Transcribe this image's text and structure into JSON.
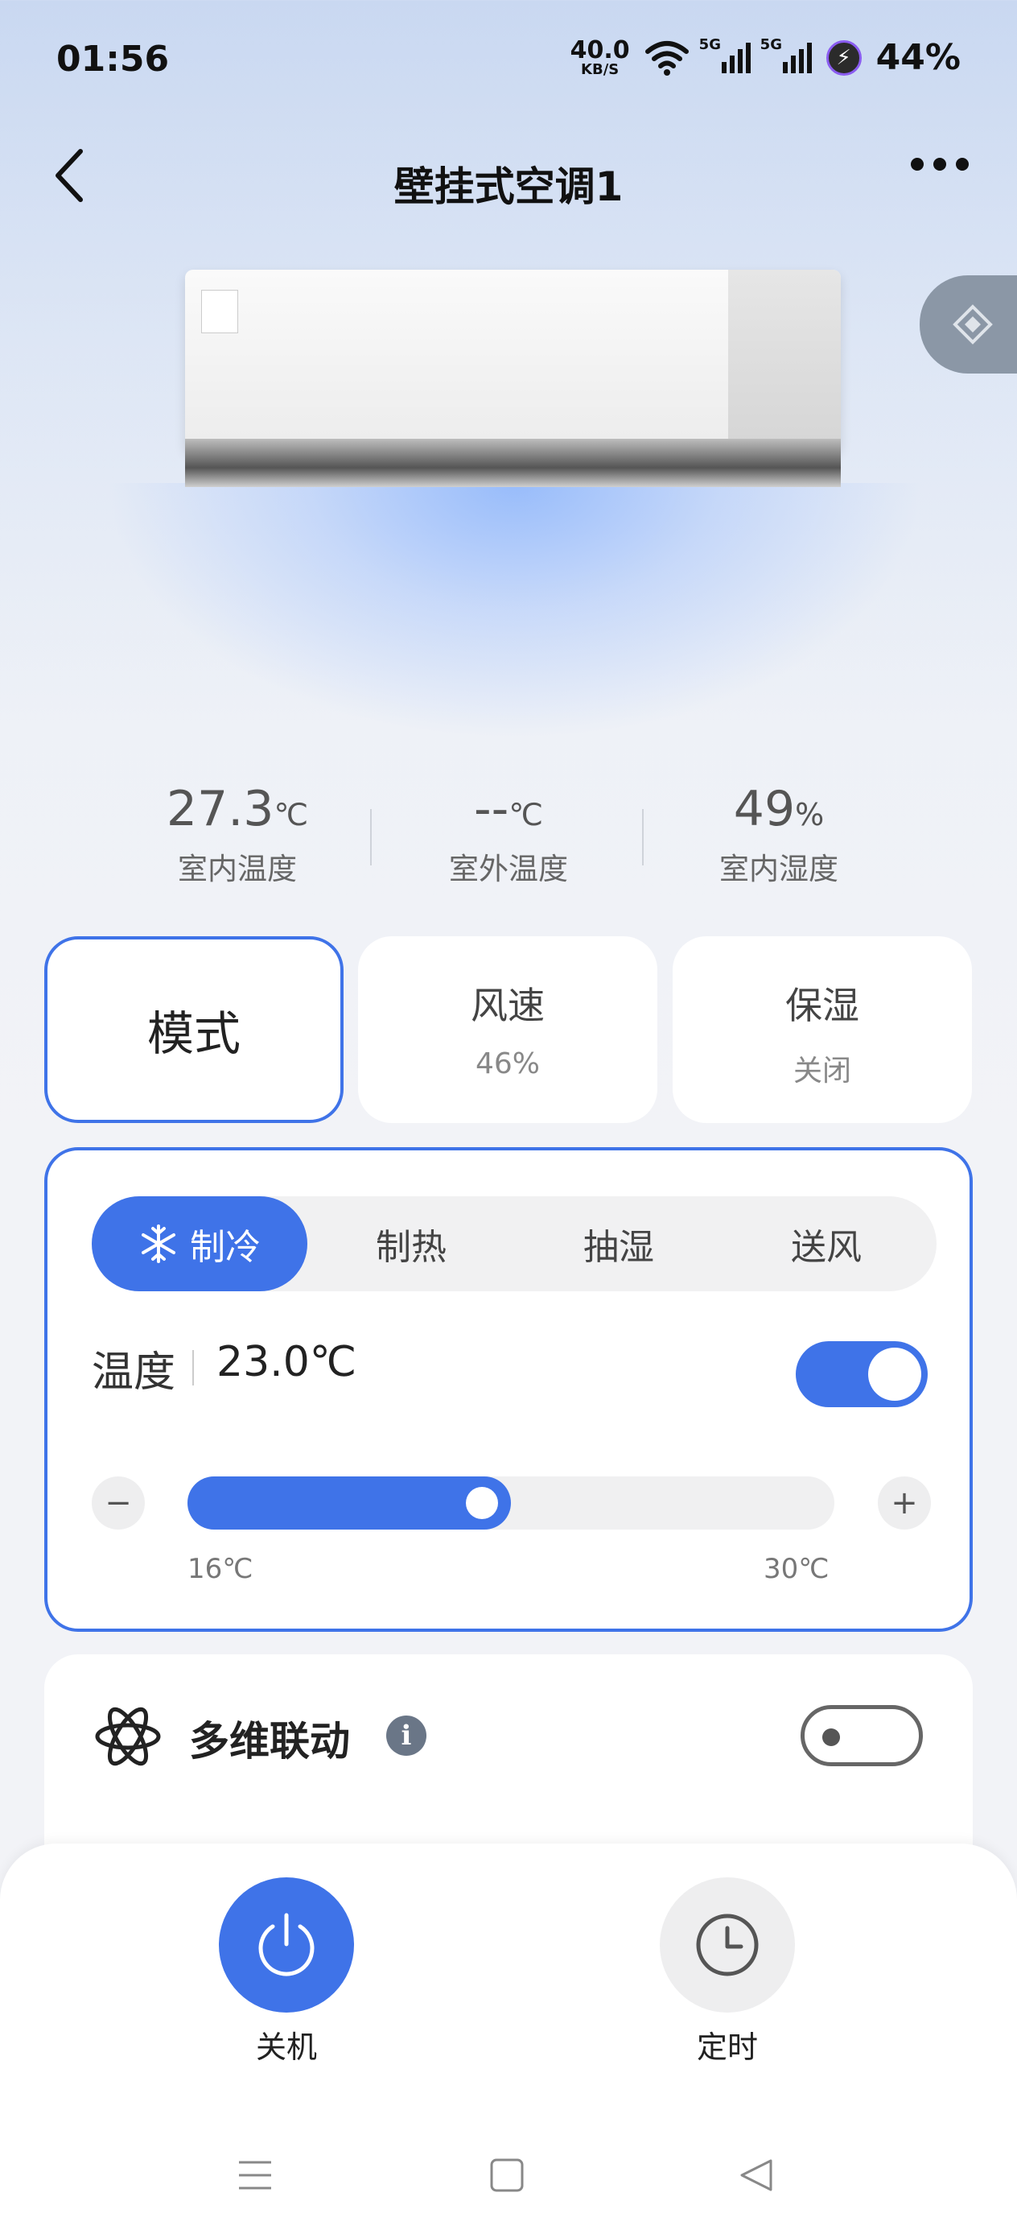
{
  "status_bar": {
    "time": "01:56",
    "net_speed": "40.0",
    "net_speed_unit": "KB/S",
    "signal_1": "5G",
    "signal_2": "5G",
    "battery": "44%"
  },
  "header": {
    "title": "壁挂式空调1",
    "icons": [
      "back-icon",
      "more-icon"
    ]
  },
  "readings": [
    {
      "value": "27.3",
      "unit": "℃",
      "label": "室内温度"
    },
    {
      "value": "--",
      "unit": "℃",
      "label": "室外温度"
    },
    {
      "value": "49",
      "unit": "%",
      "label": "室内湿度"
    }
  ],
  "cards": {
    "mode": {
      "title": "模式"
    },
    "fan": {
      "title": "风速",
      "value": "46%"
    },
    "humidify": {
      "title": "保湿",
      "value": "关闭"
    }
  },
  "mode_panel": {
    "tabs": [
      "制冷",
      "制热",
      "抽湿",
      "送风"
    ],
    "active_tab": 0,
    "temp_label": "温度",
    "temp_value": "23.0℃",
    "temp_toggle_on": true,
    "min": "16℃",
    "max": "30℃",
    "slider_level": 0.5,
    "minus": "−",
    "plus": "+"
  },
  "linkage": {
    "title": "多维联动",
    "toggle_on": false
  },
  "bottom": {
    "power_label": "关机",
    "timer_label": "定时"
  },
  "colors": {
    "accent": "#3f73e8",
    "card_bg": "#ffffff",
    "page_bg": "#f2f3f7"
  }
}
